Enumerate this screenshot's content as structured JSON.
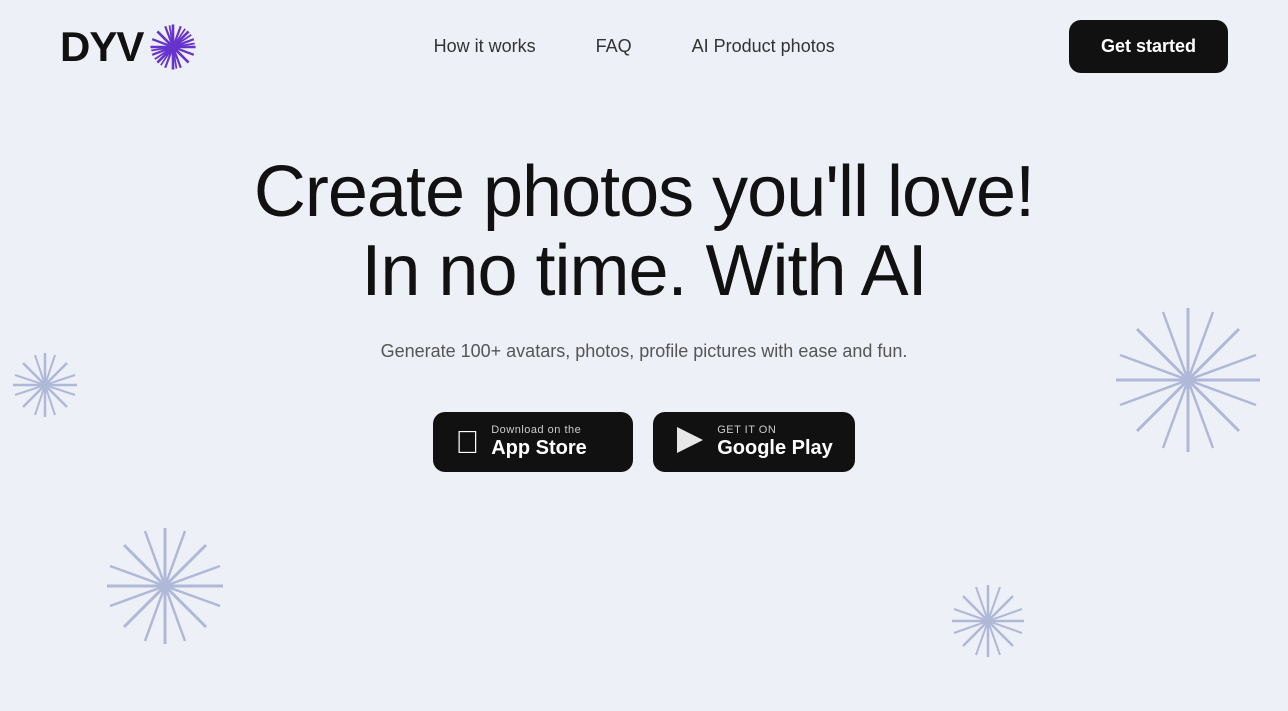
{
  "navbar": {
    "logo_text": "DYV",
    "nav_links": [
      {
        "label": "How it works",
        "id": "how-it-works"
      },
      {
        "label": "FAQ",
        "id": "faq"
      },
      {
        "label": "AI Product photos",
        "id": "ai-product-photos"
      }
    ],
    "cta_label": "Get started"
  },
  "hero": {
    "title_line1": "Create photos you'll love!",
    "title_line2": "In no time. With AI",
    "subtitle": "Generate 100+ avatars, photos, profile pictures with ease and fun."
  },
  "app_buttons": {
    "appstore": {
      "small_text": "Download on the",
      "big_text": "App Store"
    },
    "google_play": {
      "small_text": "GET IT ON",
      "big_text": "Google Play"
    }
  },
  "colors": {
    "background": "#eef0f7",
    "button_bg": "#111111",
    "button_text": "#ffffff",
    "nav_text": "#333333",
    "hero_title": "#111111",
    "hero_subtitle": "#555555",
    "starburst_purple": "#6633cc",
    "starburst_light": "#b0b8d8"
  }
}
